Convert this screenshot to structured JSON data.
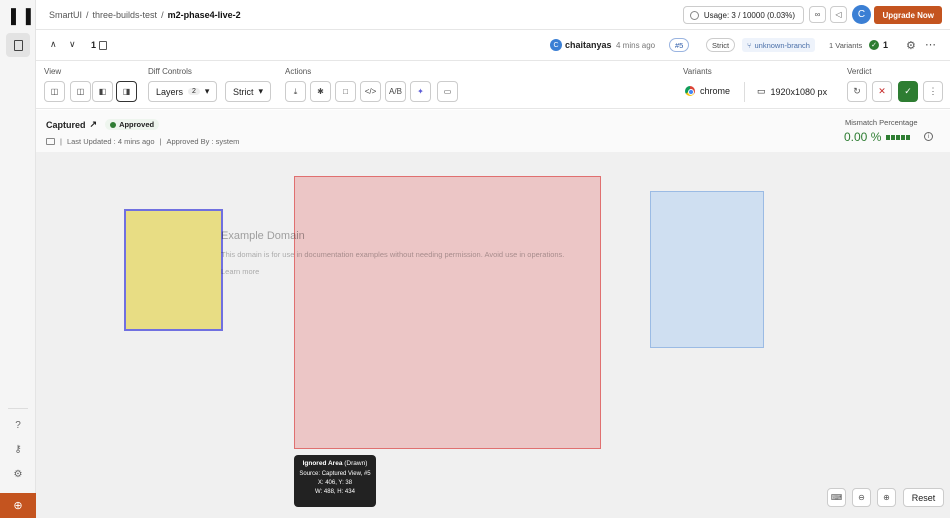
{
  "breadcrumb": {
    "org": "SmartUI",
    "project": "three-builds-test",
    "build": "m2-phase4-live-2",
    "separator": "/"
  },
  "usage": {
    "text": "Usage: 3 / 10000 (0.03%)"
  },
  "top_avatar": {
    "initial": "C"
  },
  "upgrade": {
    "label": "Upgrade Now"
  },
  "nav": {
    "index": "1"
  },
  "author": {
    "initial": "C",
    "name": "chaitanyas",
    "ago": "4 mins ago"
  },
  "build_badge": "#5",
  "mode_badge": "Strict",
  "branch": "unknown-branch",
  "variants_count": "1 Variants",
  "approved_count": "1",
  "sections": {
    "view": "View",
    "diff": "Diff Controls",
    "actions": "Actions",
    "variants": "Variants",
    "verdict": "Verdict"
  },
  "diff_controls": {
    "layers_label": "Layers",
    "layers_count": "2",
    "strict_label": "Strict"
  },
  "action_icons": {
    "ab": "A/B"
  },
  "variants": {
    "browser": "chrome",
    "resolution": "1920x1080 px"
  },
  "snapshot": {
    "status_label": "Captured",
    "badge": "Approved",
    "last_updated": "Last Updated : 4 mins ago",
    "approved_by": "Approved By : system",
    "meta_sep": "|"
  },
  "mismatch": {
    "label": "Mismatch Percentage",
    "value": "0.00 %"
  },
  "page_preview": {
    "title": "Example Domain",
    "text": "This domain is for use in documentation examples without needing permission. Avoid use in operations.",
    "link": "Learn more"
  },
  "tooltip": {
    "title": "Ignored Area",
    "subtitle": "(Drawn)",
    "source": "Source: Captured View, #5",
    "xy": "X: 406, Y: 38",
    "wh": "W: 488, H: 434"
  },
  "canvas_controls": {
    "reset": "Reset"
  },
  "colors": {
    "accent": "#c4541f",
    "approved": "#2e7d32",
    "ignored_area": "#ebbebe",
    "yellow_area": "#e8dd84",
    "blue_area": "#cfdff1"
  }
}
